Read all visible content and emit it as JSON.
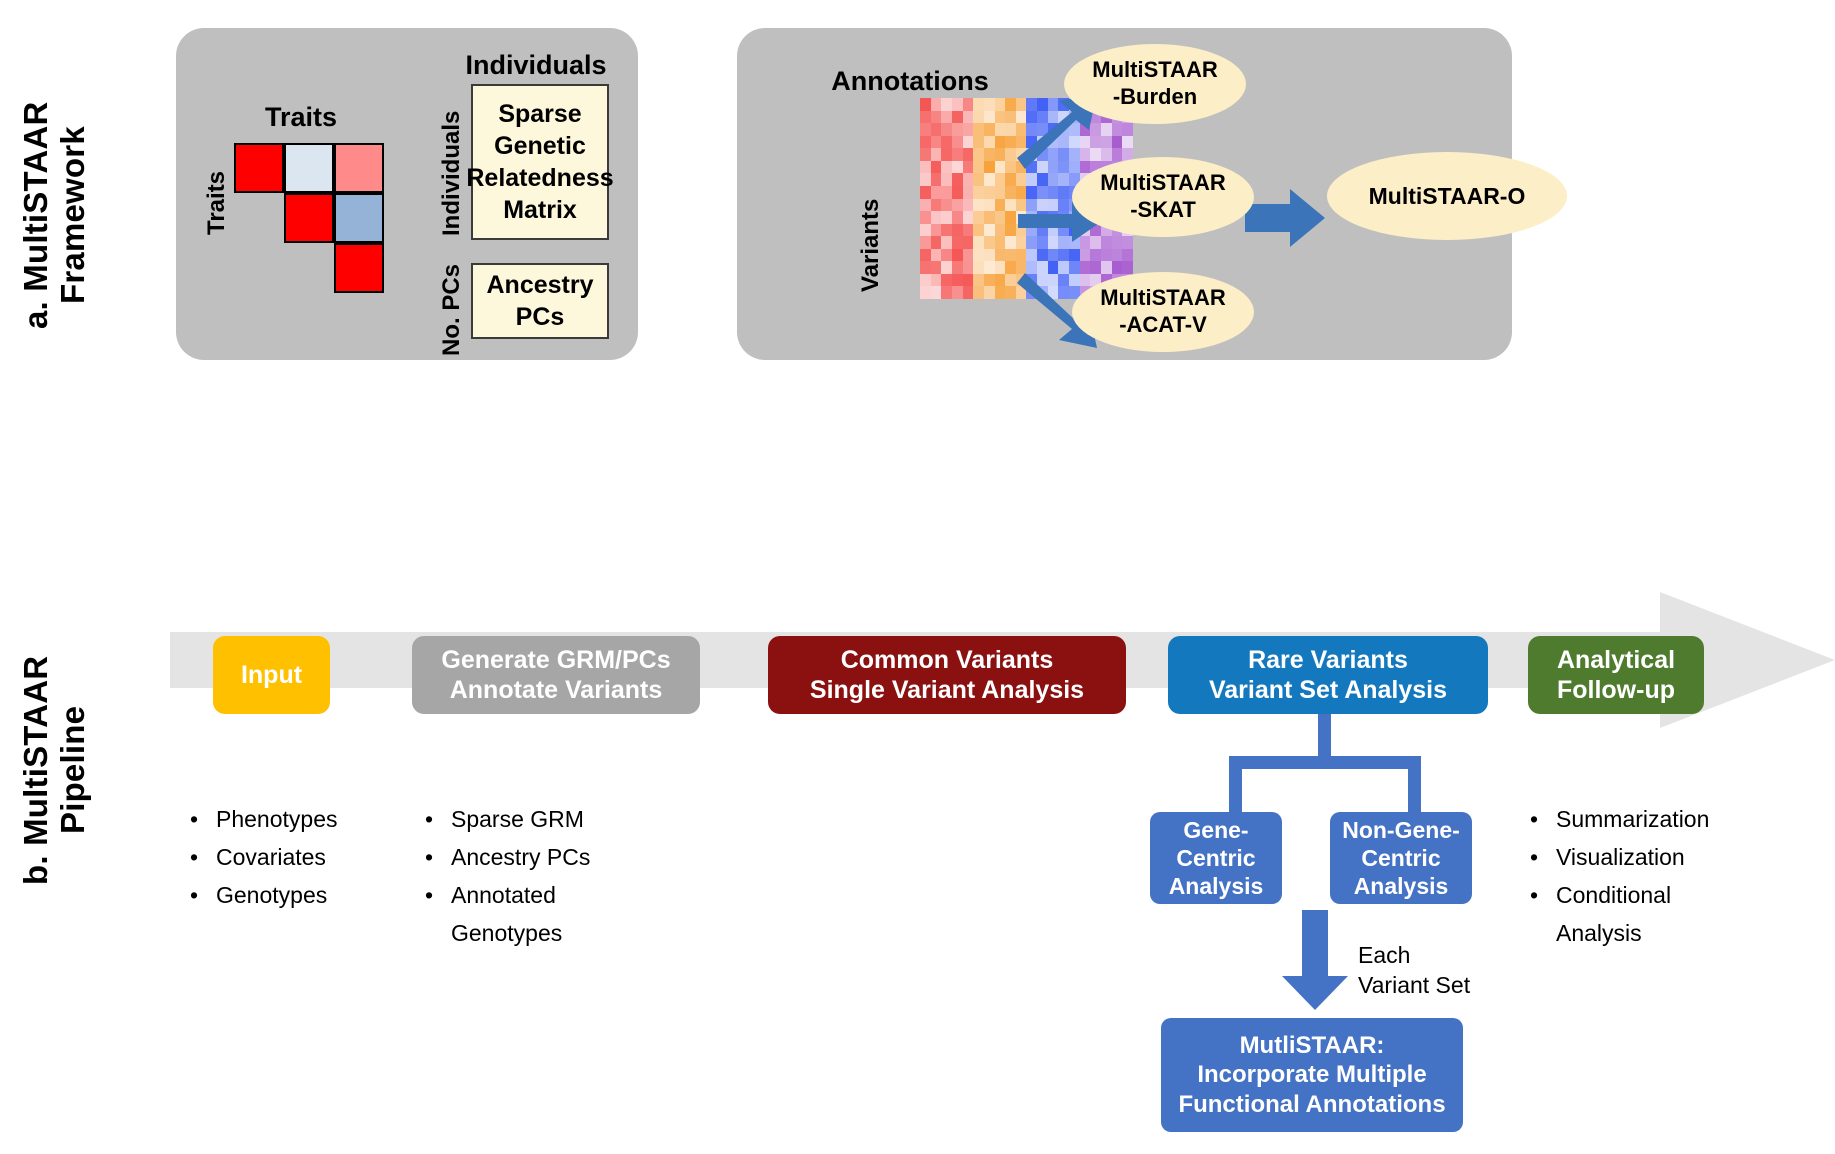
{
  "figure": {
    "panels": [
      {
        "id": "a",
        "label": "a. MultiSTAAR\nFramework"
      },
      {
        "id": "b",
        "label": "b. MultiSTAAR\nPipeline"
      }
    ]
  },
  "panel_a": {
    "label_line1": "a. MultiSTAAR",
    "label_line2": "Framework",
    "card_left": {
      "matrix": {
        "top_label": "Traits",
        "left_label": "Traits",
        "description": "upper-triangular trait correlation matrix, 3x3",
        "colors": {
          "diagonal": "#FF0000",
          "pale_blue": "#DCE6F1",
          "salmon": "#FF8A8A",
          "steel_blue": "#95B3D7"
        },
        "cells": [
          {
            "row": 0,
            "col": 0,
            "color": "#FF0000"
          },
          {
            "row": 0,
            "col": 1,
            "color": "#DCE6F1"
          },
          {
            "row": 0,
            "col": 2,
            "color": "#FF8A8A"
          },
          {
            "row": 1,
            "col": 1,
            "color": "#FF0000"
          },
          {
            "row": 1,
            "col": 2,
            "color": "#95B3D7"
          },
          {
            "row": 2,
            "col": 2,
            "color": "#FF0000"
          }
        ]
      },
      "grm": {
        "top_label": "Individuals",
        "left_label": "Individuals",
        "text": "Sparse\nGenetic\nRelatedness\nMatrix"
      },
      "pcs": {
        "left_label": "No. PCs",
        "text": "Ancestry\nPCs"
      }
    },
    "card_right": {
      "annotations": {
        "top_label": "Annotations",
        "left_label": "Variants",
        "block_colors": [
          "#F4514F",
          "#F7A23B",
          "#3B5BF5",
          "#A75BD0"
        ],
        "rows": 16,
        "cols": 20
      },
      "tests": [
        {
          "line1": "MultiSTAAR",
          "line2": "-Burden"
        },
        {
          "line1": "MultiSTAAR",
          "line2": "-SKAT"
        },
        {
          "line1": "MultiSTAAR",
          "line2": "-ACAT-V"
        }
      ],
      "omnibus": "MultiSTAAR-O",
      "arrow_color": "#3B74B8"
    }
  },
  "panel_b": {
    "label_line1": "b. MultiSTAAR",
    "label_line2": "Pipeline",
    "stages": [
      {
        "text": "Input",
        "color": "#FFC000",
        "lines": [
          "Input"
        ]
      },
      {
        "text": "Generate GRM/PCs Annotate Variants",
        "color": "#A6A6A6",
        "lines": [
          "Generate GRM/PCs",
          "Annotate Variants"
        ]
      },
      {
        "text": "Common Variants Single Variant Analysis",
        "color": "#8B1010",
        "lines": [
          "Common Variants",
          "Single Variant Analysis"
        ]
      },
      {
        "text": "Rare Variants Variant Set Analysis",
        "color": "#1478BE",
        "lines": [
          "Rare Variants",
          "Variant Set Analysis"
        ]
      },
      {
        "text": "Analytical Follow-up",
        "color": "#4F7B2E",
        "lines": [
          "Analytical",
          "Follow-up"
        ]
      }
    ],
    "bullets_input": [
      "Phenotypes",
      "Covariates",
      "Genotypes"
    ],
    "bullets_grm": [
      "Sparse GRM",
      "Ancestry PCs",
      "Annotated"
    ],
    "bullets_grm_wrap": "Genotypes",
    "bullets_followup": [
      "Summarization",
      "Visualization",
      "Conditional"
    ],
    "bullets_followup_wrap": "Analysis",
    "branch_boxes": [
      {
        "lines": [
          "Gene-",
          "Centric",
          "Analysis"
        ]
      },
      {
        "lines": [
          "Non-Gene-",
          "Centric",
          "Analysis"
        ]
      }
    ],
    "arrow_note": [
      "Each",
      "Variant Set"
    ],
    "final_box": [
      "MutliSTAAR:",
      "Incorporate Multiple",
      "Functional Annotations"
    ],
    "accent_blue": "#4472C4",
    "bar_color": "#E4E4E4"
  }
}
